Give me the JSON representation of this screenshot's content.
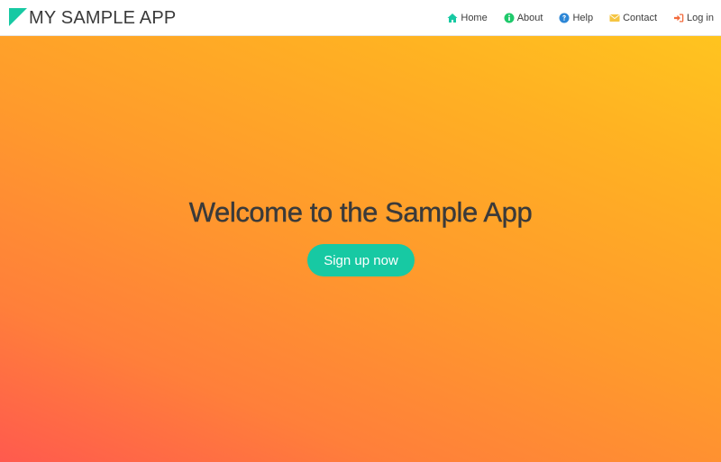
{
  "brand": {
    "name": "MY SAMPLE APP",
    "logo_icon": "triangle-logo-icon",
    "logo_color": "#17c9a3"
  },
  "nav": {
    "items": [
      {
        "label": "Home",
        "icon": "home-icon",
        "color": "#17c9a3"
      },
      {
        "label": "About",
        "icon": "info-circle-icon",
        "color": "#1fc96b"
      },
      {
        "label": "Help",
        "icon": "question-circle-icon",
        "color": "#2c86d6"
      },
      {
        "label": "Contact",
        "icon": "envelope-icon",
        "color": "#f5c542"
      },
      {
        "label": "Log in",
        "icon": "sign-in-icon",
        "color": "#f26a3b"
      }
    ]
  },
  "hero": {
    "title": "Welcome to the Sample App",
    "cta_label": "Sign up now",
    "cta_color": "#17c9a3",
    "gradient": [
      "#ff5a4e",
      "#ff9a2c",
      "#ffc41f"
    ]
  }
}
